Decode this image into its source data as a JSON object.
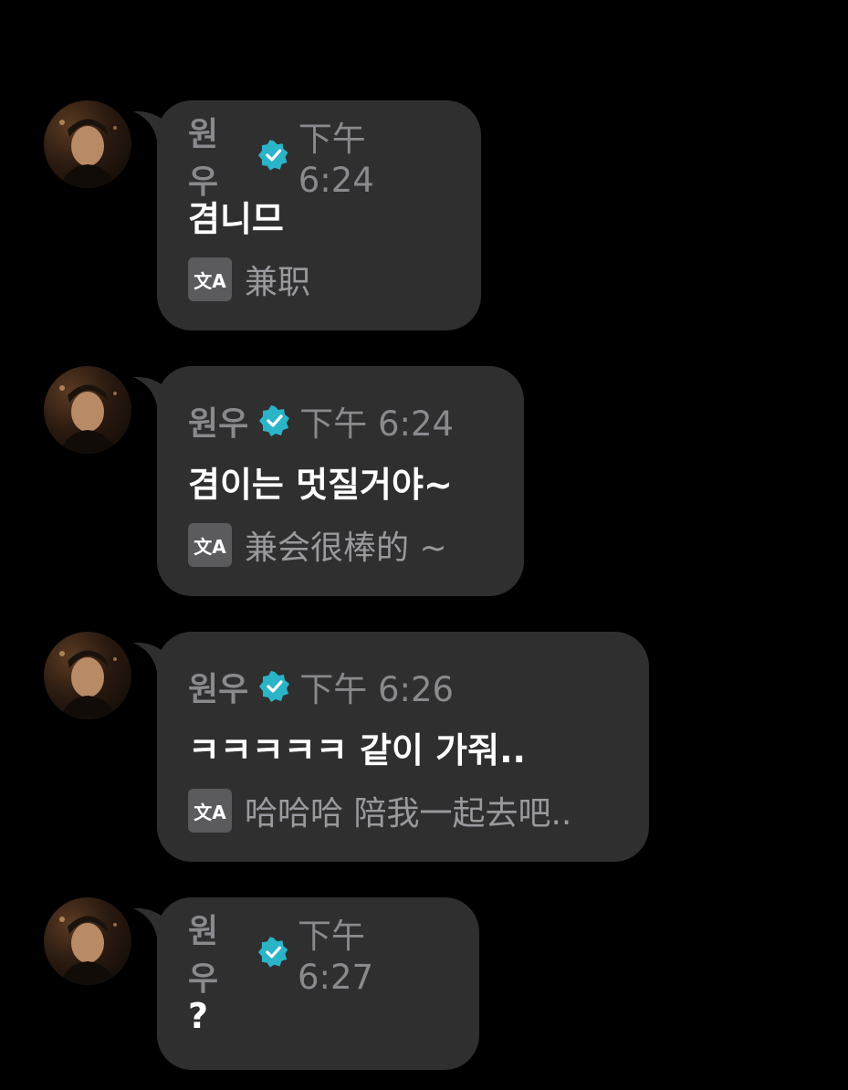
{
  "messages": [
    {
      "sender": "원우",
      "time": "下午 6:24",
      "text": "겸니므",
      "translation": "兼职"
    },
    {
      "sender": "원우",
      "time": "下午 6:24",
      "text": "겸이는 멋질거야~",
      "translation": "兼会很棒的 ~"
    },
    {
      "sender": "원우",
      "time": "下午 6:26",
      "text": "ㅋㅋㅋㅋㅋ 같이 가줘..",
      "translation": "哈哈哈 陪我一起去吧.."
    },
    {
      "sender": "원우",
      "time": "下午 6:27",
      "text": "?"
    }
  ],
  "translate_icon_label": "文A",
  "colors": {
    "background": "#000000",
    "bubble": "#2f2f2f",
    "verified_badge": "#2bb4c8",
    "secondary_text": "#8a8a8e"
  }
}
